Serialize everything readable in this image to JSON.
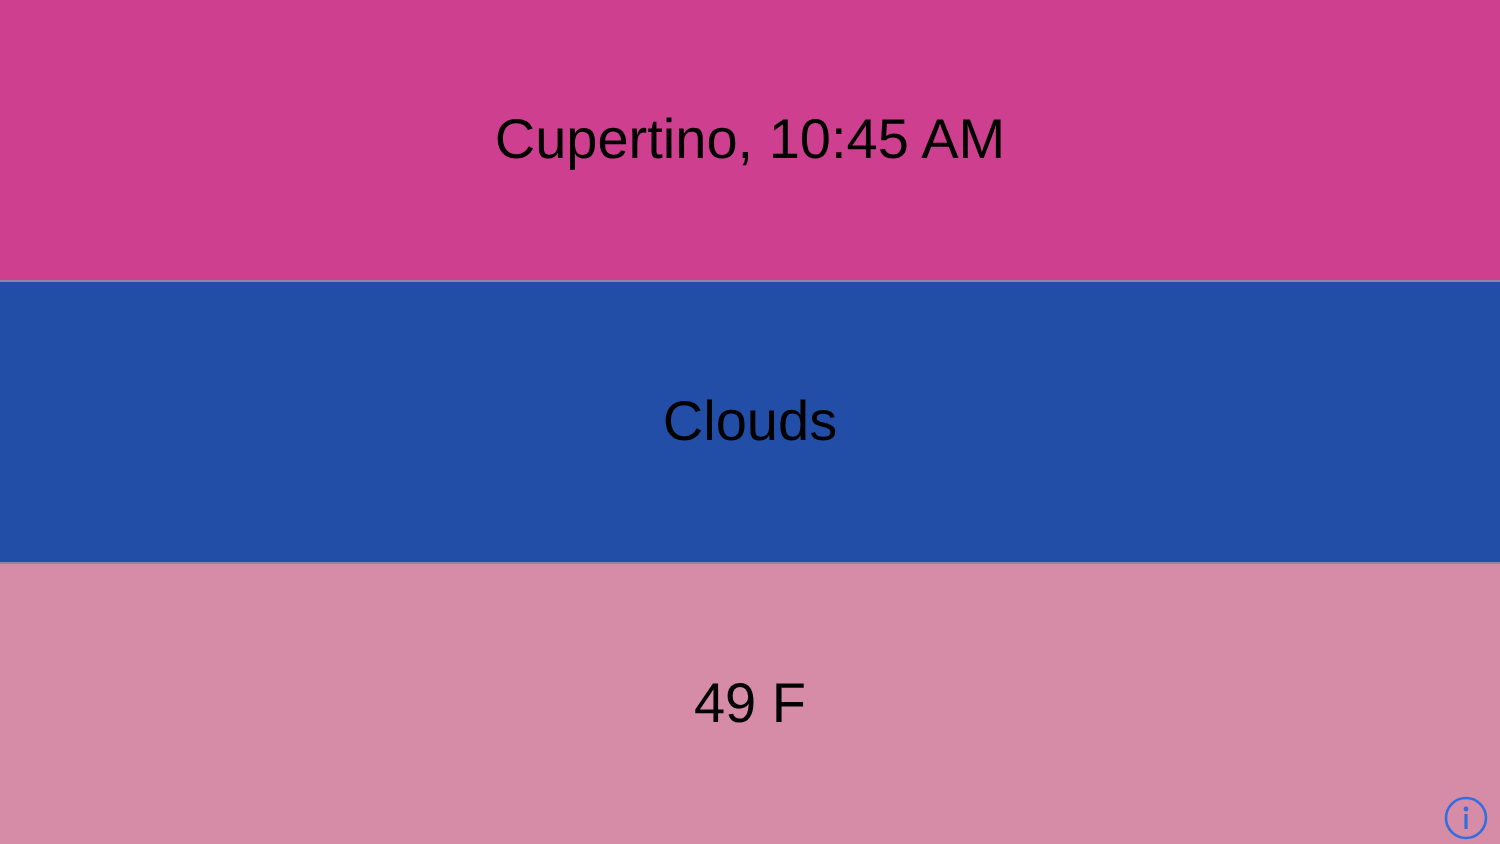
{
  "bands": [
    {
      "text": "Cupertino, 10:45 AM",
      "color": "#cf3f8f"
    },
    {
      "text": "Clouds",
      "color": "#234ea8"
    },
    {
      "text": "49 F",
      "color": "#d68ba6"
    }
  ],
  "info_button": {
    "kind": "info"
  }
}
